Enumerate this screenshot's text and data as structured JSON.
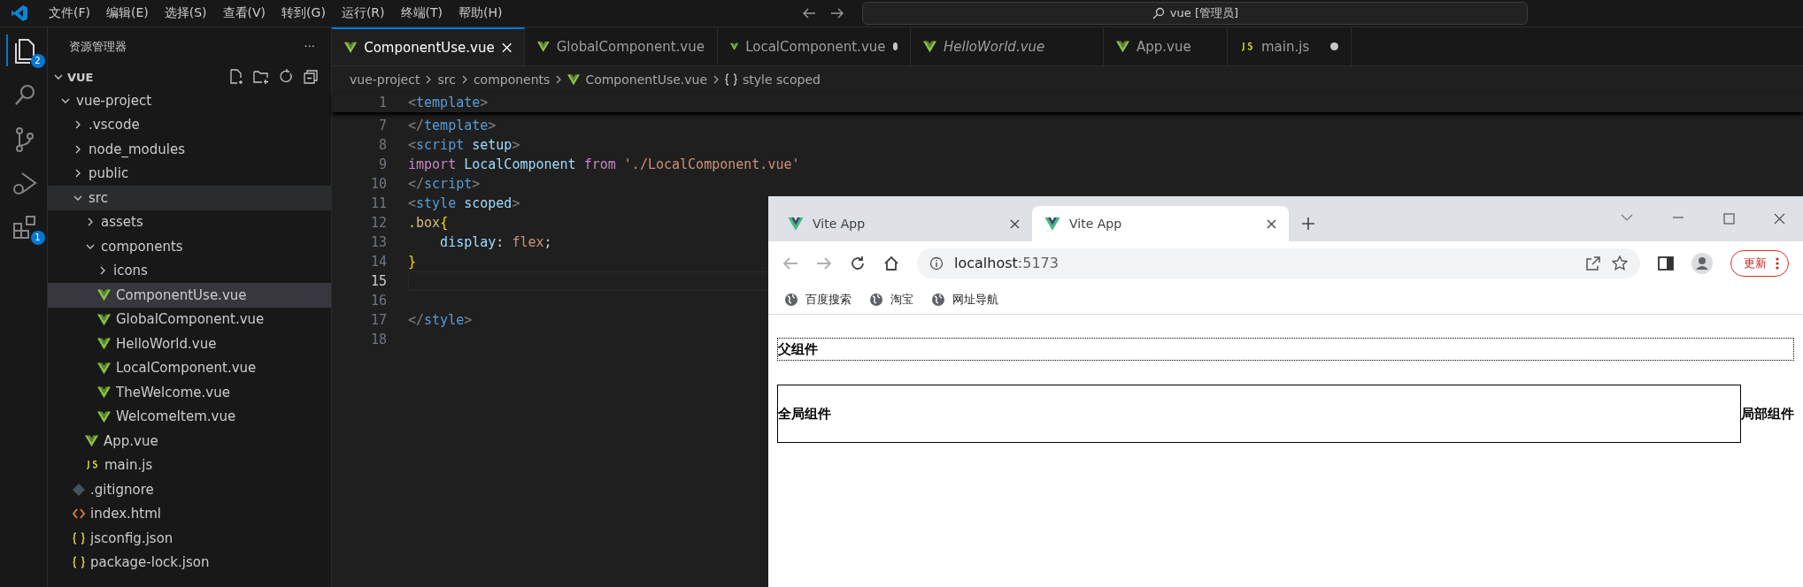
{
  "menu": [
    "文件(F)",
    "编辑(E)",
    "选择(S)",
    "查看(V)",
    "转到(G)",
    "运行(R)",
    "终端(T)",
    "帮助(H)"
  ],
  "command_center": "vue [管理员]",
  "activity_bar": [
    {
      "kind": "files",
      "badge": "2",
      "selected": true
    },
    {
      "kind": "search",
      "selected": false
    },
    {
      "kind": "git",
      "selected": false
    },
    {
      "kind": "debug",
      "selected": false
    },
    {
      "kind": "extensions",
      "badge": "1",
      "selected": false
    }
  ],
  "sidebar": {
    "title": "资源管理器",
    "more": "···",
    "section": "VUE",
    "tree": [
      {
        "name": "vue-project",
        "kind": "folder",
        "expanded": true,
        "selected": false,
        "highlighted": false,
        "children": [
          {
            "name": ".vscode",
            "kind": "folder",
            "expanded": false,
            "selected": false,
            "highlighted": false
          },
          {
            "name": "node_modules",
            "kind": "folder",
            "expanded": false,
            "selected": false,
            "highlighted": false
          },
          {
            "name": "public",
            "kind": "folder",
            "expanded": false,
            "selected": false,
            "highlighted": false
          },
          {
            "name": "src",
            "kind": "folder",
            "expanded": true,
            "selected": false,
            "highlighted": true,
            "children": [
              {
                "name": "assets",
                "kind": "folder",
                "expanded": false,
                "selected": false,
                "highlighted": false
              },
              {
                "name": "components",
                "kind": "folder",
                "expanded": true,
                "selected": false,
                "highlighted": false,
                "children": [
                  {
                    "name": "icons",
                    "kind": "folder",
                    "expanded": false,
                    "selected": false,
                    "highlighted": false
                  },
                  {
                    "name": "ComponentUse.vue",
                    "kind": "vue",
                    "selected": true,
                    "highlighted": false
                  },
                  {
                    "name": "GlobalComponent.vue",
                    "kind": "vue",
                    "selected": false,
                    "highlighted": false
                  },
                  {
                    "name": "HelloWorld.vue",
                    "kind": "vue",
                    "selected": false,
                    "highlighted": false
                  },
                  {
                    "name": "LocalComponent.vue",
                    "kind": "vue",
                    "selected": false,
                    "highlighted": false
                  },
                  {
                    "name": "TheWelcome.vue",
                    "kind": "vue",
                    "selected": false,
                    "highlighted": false
                  },
                  {
                    "name": "WelcomeItem.vue",
                    "kind": "vue",
                    "selected": false,
                    "highlighted": false
                  }
                ]
              },
              {
                "name": "App.vue",
                "kind": "vue",
                "selected": false,
                "highlighted": false
              },
              {
                "name": "main.js",
                "kind": "js",
                "selected": false,
                "highlighted": false
              }
            ]
          },
          {
            "name": ".gitignore",
            "kind": "git",
            "selected": false,
            "highlighted": false
          },
          {
            "name": "index.html",
            "kind": "html",
            "selected": false,
            "highlighted": false
          },
          {
            "name": "jsconfig.json",
            "kind": "json",
            "selected": false,
            "highlighted": false
          },
          {
            "name": "package-lock.json",
            "kind": "json",
            "selected": false,
            "highlighted": false
          }
        ]
      }
    ]
  },
  "editor_tabs": [
    {
      "label": "ComponentUse.vue",
      "kind": "vue",
      "selected": true,
      "modified": false,
      "preview": false
    },
    {
      "label": "GlobalComponent.vue",
      "kind": "vue",
      "selected": false,
      "modified": false,
      "preview": false
    },
    {
      "label": "LocalComponent.vue",
      "kind": "vue",
      "selected": false,
      "modified": true,
      "preview": false
    },
    {
      "label": "HelloWorld.vue",
      "kind": "vue",
      "selected": false,
      "modified": false,
      "preview": true
    },
    {
      "label": "App.vue",
      "kind": "vue",
      "selected": false,
      "modified": false,
      "preview": false
    },
    {
      "label": "main.js",
      "kind": "js",
      "selected": false,
      "modified": true,
      "preview": false
    }
  ],
  "breadcrumbs": [
    {
      "text": "vue-project",
      "kind": "folder"
    },
    {
      "text": "src",
      "kind": "folder"
    },
    {
      "text": "components",
      "kind": "folder"
    },
    {
      "text": "ComponentUse.vue",
      "kind": "vue"
    },
    {
      "text": "style scoped",
      "kind": "block"
    }
  ],
  "code": [
    {
      "number": "1",
      "sticky": true,
      "current": false,
      "tokens": [
        {
          "text": "<",
          "kind": "punct"
        },
        {
          "text": "template",
          "kind": "tag"
        },
        {
          "text": ">",
          "kind": "punct"
        }
      ]
    },
    {
      "number": "7",
      "sticky": false,
      "current": false,
      "tokens": [
        {
          "text": "</",
          "kind": "punct"
        },
        {
          "text": "template",
          "kind": "tag"
        },
        {
          "text": ">",
          "kind": "punct"
        }
      ]
    },
    {
      "number": "8",
      "sticky": false,
      "current": false,
      "tokens": [
        {
          "text": "<",
          "kind": "punct"
        },
        {
          "text": "script",
          "kind": "tag"
        },
        {
          "text": " setup",
          "kind": "attr"
        },
        {
          "text": ">",
          "kind": "punct"
        }
      ]
    },
    {
      "number": "9",
      "sticky": false,
      "current": false,
      "tokens": [
        {
          "text": "import",
          "kind": "keyword"
        },
        {
          "text": " LocalComponent",
          "kind": "attr"
        },
        {
          "text": " from",
          "kind": "keyword"
        },
        {
          "text": " './LocalComponent.vue'",
          "kind": "string"
        }
      ]
    },
    {
      "number": "10",
      "sticky": false,
      "current": false,
      "tokens": [
        {
          "text": "</",
          "kind": "punct"
        },
        {
          "text": "script",
          "kind": "tag"
        },
        {
          "text": ">",
          "kind": "punct"
        }
      ]
    },
    {
      "number": "11",
      "sticky": false,
      "current": false,
      "tokens": [
        {
          "text": "<",
          "kind": "punct"
        },
        {
          "text": "style",
          "kind": "tag"
        },
        {
          "text": " scoped",
          "kind": "attr"
        },
        {
          "text": ">",
          "kind": "punct"
        }
      ]
    },
    {
      "number": "12",
      "sticky": false,
      "current": false,
      "tokens": [
        {
          "text": ".box",
          "kind": "selector"
        },
        {
          "text": "{",
          "kind": "brace"
        }
      ]
    },
    {
      "number": "13",
      "sticky": false,
      "current": false,
      "tokens": [
        {
          "text": "    display",
          "kind": "attr"
        },
        {
          "text": ":",
          "kind": "plain"
        },
        {
          "text": " flex",
          "kind": "string"
        },
        {
          "text": ";",
          "kind": "plain"
        }
      ]
    },
    {
      "number": "14",
      "sticky": false,
      "current": false,
      "tokens": [
        {
          "text": "}",
          "kind": "brace"
        }
      ]
    },
    {
      "number": "15",
      "sticky": false,
      "current": true
    },
    {
      "number": "16",
      "sticky": false,
      "current": false
    },
    {
      "number": "17",
      "sticky": false,
      "current": false,
      "tokens": [
        {
          "text": "</",
          "kind": "punct"
        },
        {
          "text": "style",
          "kind": "tag"
        },
        {
          "text": ">",
          "kind": "punct"
        }
      ]
    },
    {
      "number": "18",
      "sticky": false,
      "current": false
    }
  ],
  "browser": {
    "tabs": [
      {
        "title": "Vite App",
        "selected": false
      },
      {
        "title": "Vite App",
        "selected": true
      }
    ],
    "address_host": "localhost",
    "address_port": ":5173",
    "update_button": "更新",
    "bookmarks": [
      "百度搜索",
      "淘宝",
      "网址导航"
    ],
    "page": {
      "parent_label": "父组件",
      "global_label": "全局组件",
      "local_label": "局部组件"
    }
  }
}
